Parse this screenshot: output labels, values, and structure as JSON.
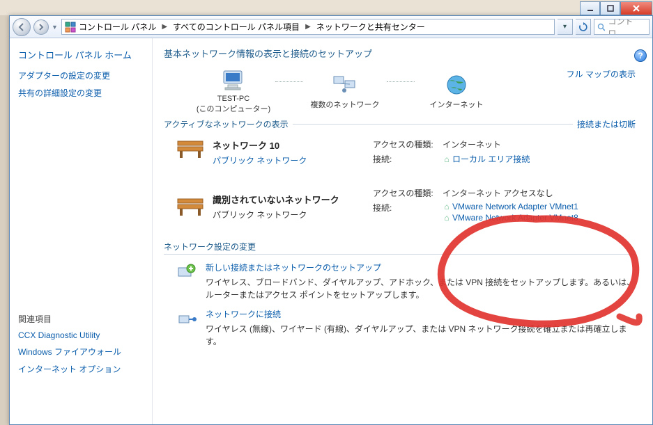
{
  "window_controls": {
    "min": "_",
    "max": "□",
    "close": "×"
  },
  "breadcrumb": {
    "icon_label": "control-panel-icon",
    "items": [
      "コントロール パネル",
      "すべてのコントロール パネル項目",
      "ネットワークと共有センター"
    ]
  },
  "searchbox": {
    "placeholder": "コントロ..."
  },
  "sidebar": {
    "home": "コントロール パネル ホーム",
    "tasks": [
      "アダプターの設定の変更",
      "共有の詳細設定の変更"
    ],
    "related_header": "関連項目",
    "related": [
      "CCX Diagnostic Utility",
      "Windows ファイアウォール",
      "インターネット オプション"
    ]
  },
  "content": {
    "title": "基本ネットワーク情報の表示と接続のセットアップ",
    "full_map": "フル マップの表示",
    "nodes": {
      "pc": {
        "name": "TEST-PC",
        "sub": "(このコンピューター)"
      },
      "multi": {
        "name": "複数のネットワーク"
      },
      "internet": {
        "name": "インターネット"
      }
    },
    "active_header": "アクティブなネットワークの表示",
    "active_link": "接続または切断",
    "labels": {
      "access_type": "アクセスの種類:",
      "connections": "接続:"
    },
    "net1": {
      "name": "ネットワーク  10",
      "type": "パブリック ネットワーク",
      "access": "インターネット",
      "conn": "ローカル エリア接続"
    },
    "net2": {
      "name": "識別されていないネットワーク",
      "type": "パブリック ネットワーク",
      "access": "インターネット アクセスなし",
      "conn1": "VMware Network Adapter VMnet1",
      "conn2": "VMware Network Adapter VMnet8"
    },
    "settings_header": "ネットワーク設定の変更",
    "settings": [
      {
        "link": "新しい接続またはネットワークのセットアップ",
        "desc": "ワイヤレス、ブロードバンド、ダイヤルアップ、アドホック、または VPN 接続をセットアップします。あるいは、ルーターまたはアクセス ポイントをセットアップします。"
      },
      {
        "link": "ネットワークに接続",
        "desc": "ワイヤレス (無線)、ワイヤード (有線)、ダイヤルアップ、または VPN ネットワーク接続を確立または再確立します。"
      }
    ]
  }
}
